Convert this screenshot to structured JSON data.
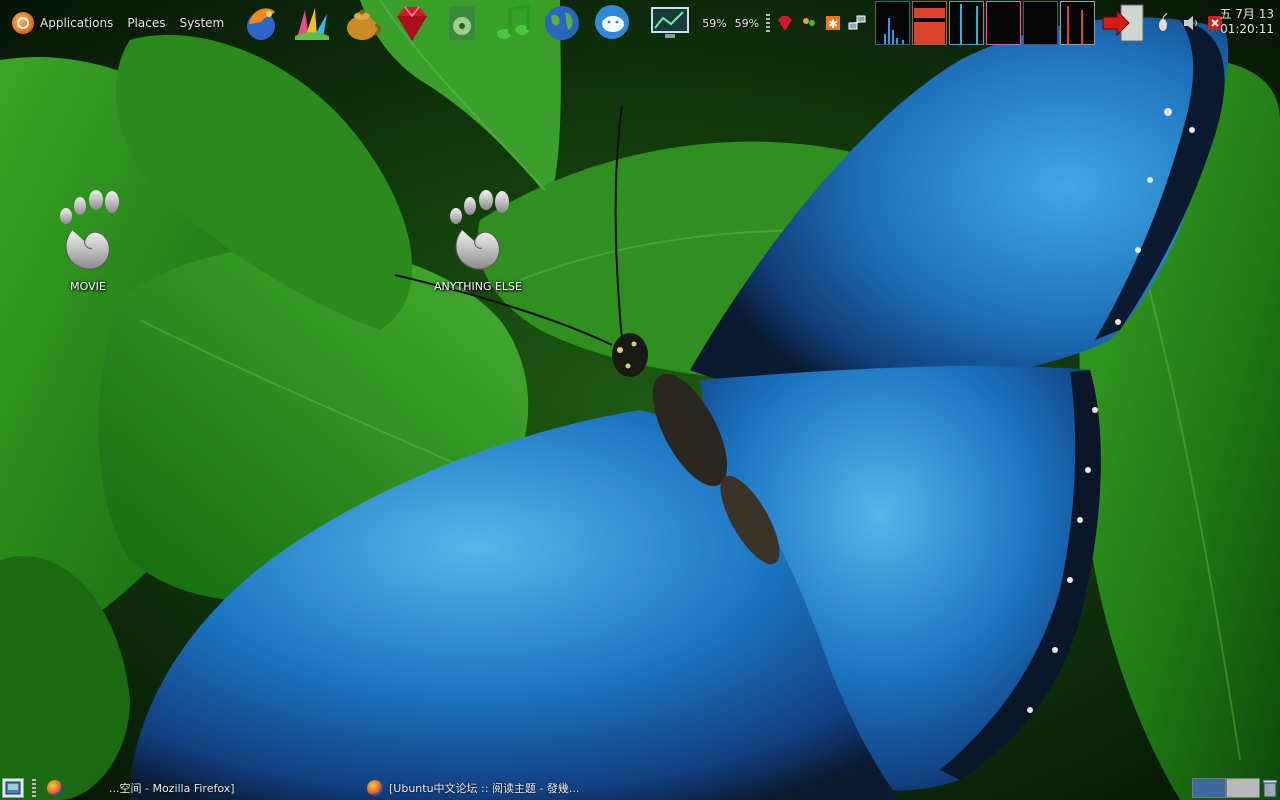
{
  "top_panel": {
    "menus": [
      "Applications",
      "Places",
      "System"
    ],
    "launchers": [
      {
        "icon": "dragon-browser-icon"
      },
      {
        "icon": "paint-brush-icon"
      },
      {
        "icon": "teapot-icon"
      },
      {
        "icon": "ruby-gem-icon"
      },
      {
        "icon": "media-player-icon"
      },
      {
        "icon": "music-notes-icon"
      },
      {
        "icon": "globe-icon"
      },
      {
        "icon": "chat-bubble-icon"
      }
    ],
    "cpu_text": [
      "59%",
      "59%"
    ],
    "clock": {
      "date": "五 7月 13",
      "time": "01:20:11"
    }
  },
  "desktop": {
    "icons": [
      {
        "label": "MOVIE",
        "icon": "gnome-foot-icon"
      },
      {
        "label": "ANYTHING ELSE",
        "icon": "gnome-foot-icon"
      }
    ]
  },
  "bottom_panel": {
    "tasks": [
      "...空间 - Mozilla Firefox]",
      "[Ubuntu中文论坛 :: 阅读主题 - 發幾..."
    ],
    "workspaces": 2
  },
  "colors": {
    "leaf_dark": "#0b3a08",
    "leaf_bright": "#2f9a1e",
    "wing_blue": "#1f7ec8",
    "wing_edge": "#0a1a30",
    "monitor_bar": "#2f9de0",
    "monitor_red": "#d9452a"
  }
}
